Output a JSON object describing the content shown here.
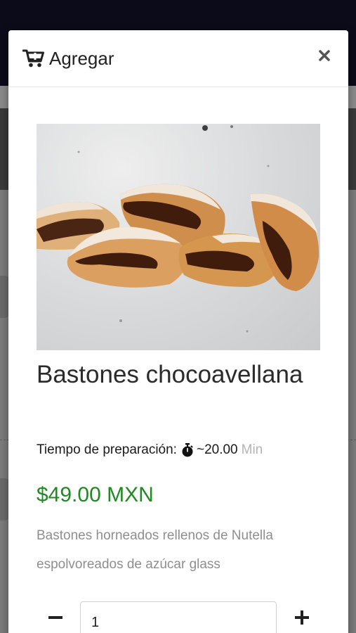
{
  "modal": {
    "title": "Agregar",
    "close_icon": "close-icon",
    "header_icon": "cart-plus-icon"
  },
  "product": {
    "name": "Bastones chocoavellana",
    "prep_label": "Tiempo de preparación:",
    "prep_value": "~20.00",
    "prep_unit": "Min",
    "price": "$49.00 MXN",
    "description": "Bastones horneados rellenos de Nutella espolvoreados de azúcar glass",
    "image_icon": "product-photo"
  },
  "quantity": {
    "value": "1",
    "minus_icon": "minus-icon",
    "plus_icon": "plus-icon"
  },
  "colors": {
    "price": "#1f8a1f",
    "unit": "#b4b4b4",
    "description": "#8e8e8e"
  }
}
